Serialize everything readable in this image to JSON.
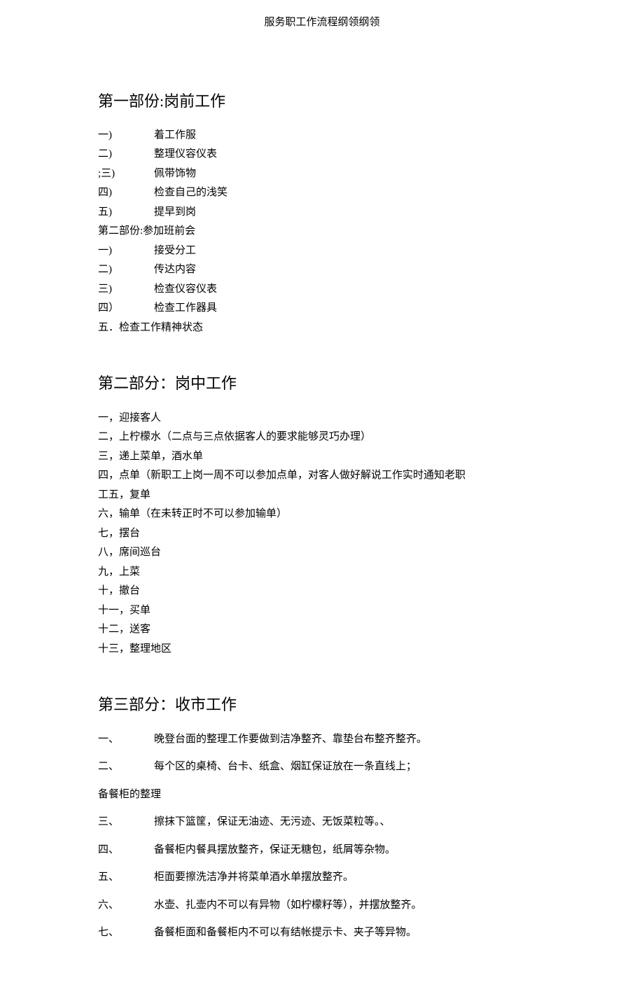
{
  "header": "服务职工作流程纲领纲领",
  "section1": {
    "title": "第一部份:岗前工作",
    "items": [
      {
        "n": "一)",
        "t": "着工作服"
      },
      {
        "n": "二)",
        "t": "整理仪容仪表"
      },
      {
        "n": ";三)",
        "t": "佩带饰物"
      },
      {
        "n": "四)",
        "t": "检查自己的浅笑"
      },
      {
        "n": "五)",
        "t": "提早到岗"
      }
    ],
    "subheader": "第二部份:参加班前会",
    "items2": [
      {
        "n": "一)",
        "t": "接受分工"
      },
      {
        "n": "二)",
        "t": "传达内容"
      },
      {
        "n": "三)",
        "t": "检查仪容仪表"
      },
      {
        "n": "四）",
        "t": "检查工作器具"
      }
    ],
    "lastLine": "五．检查工作精神状态"
  },
  "section2": {
    "title": "第二部分：岗中工作",
    "items": [
      "一，迎接客人",
      "二，上柠檬水（二点与三点依据客人的要求能够灵巧办理）",
      "三，递上菜单，酒水单",
      "四，点单（新职工上岗一周不可以参加点单，对客人做好解说工作实时通知老职",
      "工五，复单",
      "六，输单（在未转正时不可以参加输单）",
      "七，摆台",
      "八，席间巡台",
      "九，上菜",
      "十，撤台",
      "十一，买单",
      "十二，送客",
      "十三，整理地区"
    ]
  },
  "section3": {
    "title": "第三部分：收市工作",
    "items1": [
      {
        "n": "一、",
        "t": "晚登台面的整理工作要做到洁净整齐、靠垫台布整齐整齐。"
      },
      {
        "n": "二、",
        "t": "每个区的桌椅、台卡、纸盒、烟缸保证放在一条直线上；"
      }
    ],
    "subtitle": "备餐柜的整理",
    "items2": [
      {
        "n": "三、",
        "t": "擦抹下篮筐，保证无油迹、无污迹、无饭菜粒等。、"
      },
      {
        "n": "四、",
        "t": "备餐柜内餐具摆放整齐，保证无糖包，纸屑等杂物。"
      },
      {
        "n": "五、",
        "t": "柜面要擦洗洁净并将菜单酒水单摆放整齐。"
      },
      {
        "n": "六、",
        "t": "水壶、扎壶内不可以有异物（如柠檬籽等），并摆放整齐。"
      },
      {
        "n": "七、",
        "t": "备餐柜面和备餐柜内不可以有结帐提示卡、夹子等异物。"
      }
    ]
  }
}
